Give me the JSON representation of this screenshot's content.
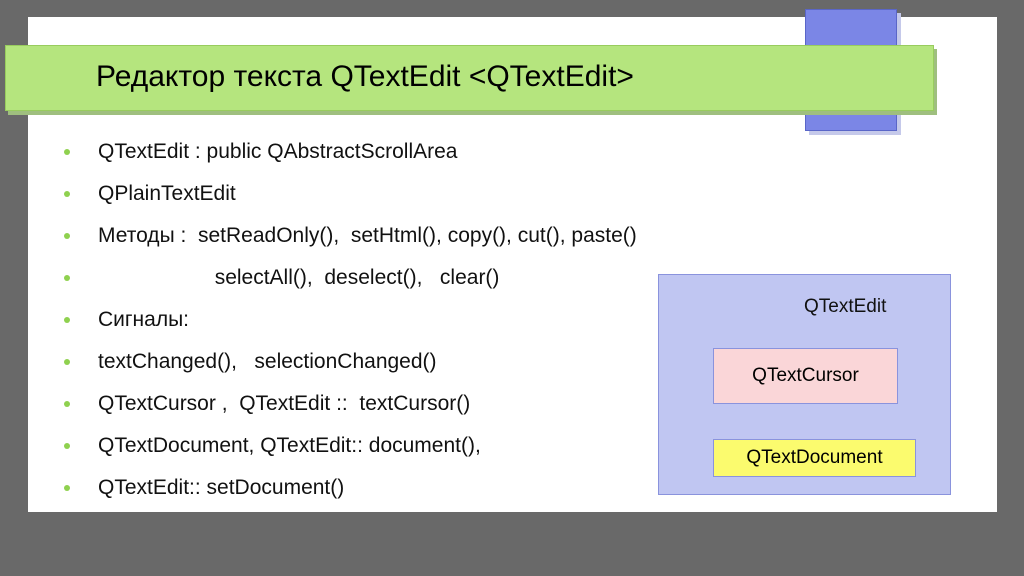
{
  "title": "Редактор текста QTextEdit <QTextEdit>",
  "bullets": [
    "QTextEdit : public QAbstractScrollArea",
    "QPlainTextEdit",
    "Методы :  setReadOnly(),  setHtml(), copy(), cut(), paste()",
    "                    selectAll(),  deselect(),   clear()",
    "Сигналы:",
    "textChanged(),   selectionChanged()",
    "QTextCursor ,  QTextEdit ::  textCursor()",
    "QTextDocument, QTextEdit:: document(),",
    "QTextEdit:: setDocument()"
  ],
  "diagram": {
    "outer": "QTextEdit",
    "cursor": "QTextCursor",
    "document": "QTextDocument"
  }
}
